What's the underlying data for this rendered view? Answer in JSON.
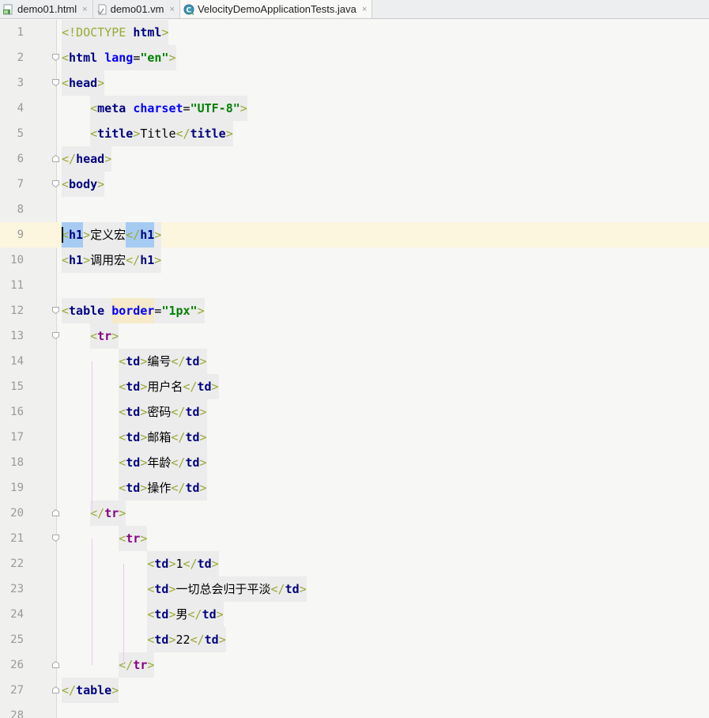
{
  "tabs": [
    {
      "label": "demo01.html",
      "icon": "html-file-icon",
      "active": false
    },
    {
      "label": "demo01.vm",
      "icon": "velocity-file-icon",
      "active": false
    },
    {
      "label": "VelocityDemoApplicationTests.java",
      "icon": "java-class-icon",
      "active": true
    }
  ],
  "close_glyph": "×",
  "editor": {
    "current_line": 9,
    "line_numbers": [
      "1",
      "2",
      "3",
      "4",
      "5",
      "6",
      "7",
      "8",
      "9",
      "10",
      "11",
      "12",
      "13",
      "14",
      "15",
      "16",
      "17",
      "18",
      "19",
      "20",
      "21",
      "22",
      "23",
      "24",
      "25",
      "26",
      "27",
      "28"
    ],
    "lines": [
      [
        {
          "t": "<",
          "c": "b"
        },
        {
          "t": "!DOCTYPE",
          "c": "b"
        },
        {
          "t": " "
        },
        {
          "t": "html",
          "c": "t"
        },
        {
          "t": ">",
          "c": "b"
        }
      ],
      [
        {
          "t": "<",
          "c": "b"
        },
        {
          "t": "html",
          "c": "t"
        },
        {
          "t": " "
        },
        {
          "t": "lang",
          "c": "a"
        },
        {
          "t": "=",
          "c": "p"
        },
        {
          "t": "\"en\"",
          "c": "v"
        },
        {
          "t": ">",
          "c": "b"
        }
      ],
      [
        {
          "t": "<",
          "c": "b"
        },
        {
          "t": "head",
          "c": "t"
        },
        {
          "t": ">",
          "c": "b"
        }
      ],
      [
        {
          "t": "    "
        },
        {
          "t": "<",
          "c": "b"
        },
        {
          "t": "meta",
          "c": "t"
        },
        {
          "t": " "
        },
        {
          "t": "charset",
          "c": "a"
        },
        {
          "t": "=",
          "c": "p"
        },
        {
          "t": "\"UTF-8\"",
          "c": "v"
        },
        {
          "t": ">",
          "c": "b"
        }
      ],
      [
        {
          "t": "    "
        },
        {
          "t": "<",
          "c": "b"
        },
        {
          "t": "title",
          "c": "t"
        },
        {
          "t": ">",
          "c": "b"
        },
        {
          "t": "Title",
          "c": "p"
        },
        {
          "t": "</",
          "c": "b"
        },
        {
          "t": "title",
          "c": "t"
        },
        {
          "t": ">",
          "c": "b"
        }
      ],
      [
        {
          "t": "</",
          "c": "b"
        },
        {
          "t": "head",
          "c": "t"
        },
        {
          "t": ">",
          "c": "b"
        }
      ],
      [
        {
          "t": "<",
          "c": "b"
        },
        {
          "t": "body",
          "c": "t"
        },
        {
          "t": ">",
          "c": "b"
        }
      ],
      [],
      [
        {
          "t": "<",
          "c": "b",
          "sel": true
        },
        {
          "t": "h1",
          "c": "t",
          "sel": true
        },
        {
          "t": ">",
          "c": "b"
        },
        {
          "t": "定义宏",
          "c": "x"
        },
        {
          "t": "</",
          "c": "b",
          "sel": true
        },
        {
          "t": "h1",
          "c": "t",
          "sel": true
        },
        {
          "t": ">",
          "c": "b"
        }
      ],
      [
        {
          "t": "<",
          "c": "b"
        },
        {
          "t": "h1",
          "c": "t"
        },
        {
          "t": ">",
          "c": "b"
        },
        {
          "t": "调用宏",
          "c": "x"
        },
        {
          "t": "</",
          "c": "b"
        },
        {
          "t": "h1",
          "c": "t"
        },
        {
          "t": ">",
          "c": "b"
        }
      ],
      [],
      [
        {
          "t": "<",
          "c": "b"
        },
        {
          "t": "table",
          "c": "t"
        },
        {
          "t": " "
        },
        {
          "t": "border",
          "c": "a",
          "warn": true
        },
        {
          "t": "=",
          "c": "p"
        },
        {
          "t": "\"1px\"",
          "c": "v"
        },
        {
          "t": ">",
          "c": "b"
        }
      ],
      [
        {
          "t": "    "
        },
        {
          "t": "<",
          "c": "b"
        },
        {
          "t": "tr",
          "c": "t2"
        },
        {
          "t": ">",
          "c": "b"
        }
      ],
      [
        {
          "t": "        "
        },
        {
          "t": "<",
          "c": "b"
        },
        {
          "t": "td",
          "c": "dt"
        },
        {
          "t": ">",
          "c": "b"
        },
        {
          "t": "编号",
          "c": "x"
        },
        {
          "t": "</",
          "c": "b"
        },
        {
          "t": "td",
          "c": "dt"
        },
        {
          "t": ">",
          "c": "b"
        }
      ],
      [
        {
          "t": "        "
        },
        {
          "t": "<",
          "c": "b"
        },
        {
          "t": "td",
          "c": "dt"
        },
        {
          "t": ">",
          "c": "b"
        },
        {
          "t": "用户名",
          "c": "x"
        },
        {
          "t": "</",
          "c": "b"
        },
        {
          "t": "td",
          "c": "dt"
        },
        {
          "t": ">",
          "c": "b"
        }
      ],
      [
        {
          "t": "        "
        },
        {
          "t": "<",
          "c": "b"
        },
        {
          "t": "td",
          "c": "dt"
        },
        {
          "t": ">",
          "c": "b"
        },
        {
          "t": "密码",
          "c": "x"
        },
        {
          "t": "</",
          "c": "b"
        },
        {
          "t": "td",
          "c": "dt"
        },
        {
          "t": ">",
          "c": "b"
        }
      ],
      [
        {
          "t": "        "
        },
        {
          "t": "<",
          "c": "b"
        },
        {
          "t": "td",
          "c": "dt"
        },
        {
          "t": ">",
          "c": "b"
        },
        {
          "t": "邮箱",
          "c": "x"
        },
        {
          "t": "</",
          "c": "b"
        },
        {
          "t": "td",
          "c": "dt"
        },
        {
          "t": ">",
          "c": "b"
        }
      ],
      [
        {
          "t": "        "
        },
        {
          "t": "<",
          "c": "b"
        },
        {
          "t": "td",
          "c": "dt"
        },
        {
          "t": ">",
          "c": "b"
        },
        {
          "t": "年龄",
          "c": "x"
        },
        {
          "t": "</",
          "c": "b"
        },
        {
          "t": "td",
          "c": "dt"
        },
        {
          "t": ">",
          "c": "b"
        }
      ],
      [
        {
          "t": "        "
        },
        {
          "t": "<",
          "c": "b"
        },
        {
          "t": "td",
          "c": "dt"
        },
        {
          "t": ">",
          "c": "b"
        },
        {
          "t": "操作",
          "c": "x"
        },
        {
          "t": "</",
          "c": "b"
        },
        {
          "t": "td",
          "c": "dt"
        },
        {
          "t": ">",
          "c": "b"
        }
      ],
      [
        {
          "t": "    "
        },
        {
          "t": "</",
          "c": "b"
        },
        {
          "t": "tr",
          "c": "t2"
        },
        {
          "t": ">",
          "c": "b"
        }
      ],
      [
        {
          "t": "        "
        },
        {
          "t": "<",
          "c": "b"
        },
        {
          "t": "tr",
          "c": "t2"
        },
        {
          "t": ">",
          "c": "b"
        }
      ],
      [
        {
          "t": "            "
        },
        {
          "t": "<",
          "c": "b"
        },
        {
          "t": "td",
          "c": "dt"
        },
        {
          "t": ">",
          "c": "b"
        },
        {
          "t": "1",
          "c": "p"
        },
        {
          "t": "</",
          "c": "b"
        },
        {
          "t": "td",
          "c": "dt"
        },
        {
          "t": ">",
          "c": "b"
        }
      ],
      [
        {
          "t": "            "
        },
        {
          "t": "<",
          "c": "b"
        },
        {
          "t": "td",
          "c": "dt"
        },
        {
          "t": ">",
          "c": "b"
        },
        {
          "t": "一切总会归于平淡",
          "c": "x"
        },
        {
          "t": "</",
          "c": "b"
        },
        {
          "t": "td",
          "c": "dt"
        },
        {
          "t": ">",
          "c": "b"
        }
      ],
      [
        {
          "t": "            "
        },
        {
          "t": "<",
          "c": "b"
        },
        {
          "t": "td",
          "c": "dt"
        },
        {
          "t": ">",
          "c": "b"
        },
        {
          "t": "男",
          "c": "x"
        },
        {
          "t": "</",
          "c": "b"
        },
        {
          "t": "td",
          "c": "dt"
        },
        {
          "t": ">",
          "c": "b"
        }
      ],
      [
        {
          "t": "            "
        },
        {
          "t": "<",
          "c": "b"
        },
        {
          "t": "td",
          "c": "dt"
        },
        {
          "t": ">",
          "c": "b"
        },
        {
          "t": "22",
          "c": "p"
        },
        {
          "t": "</",
          "c": "b"
        },
        {
          "t": "td",
          "c": "dt"
        },
        {
          "t": ">",
          "c": "b"
        }
      ],
      [
        {
          "t": "        "
        },
        {
          "t": "</",
          "c": "b"
        },
        {
          "t": "tr",
          "c": "t2"
        },
        {
          "t": ">",
          "c": "b"
        }
      ],
      [
        {
          "t": "</",
          "c": "b"
        },
        {
          "t": "table",
          "c": "t"
        },
        {
          "t": ">",
          "c": "b"
        }
      ],
      []
    ],
    "fold_markers": [
      {
        "line": 2,
        "kind": "open"
      },
      {
        "line": 3,
        "kind": "open"
      },
      {
        "line": 6,
        "kind": "close"
      },
      {
        "line": 7,
        "kind": "open"
      },
      {
        "line": 12,
        "kind": "open"
      },
      {
        "line": 13,
        "kind": "open"
      },
      {
        "line": 20,
        "kind": "close"
      },
      {
        "line": 21,
        "kind": "open"
      },
      {
        "line": 26,
        "kind": "close"
      },
      {
        "line": 27,
        "kind": "close"
      }
    ]
  }
}
